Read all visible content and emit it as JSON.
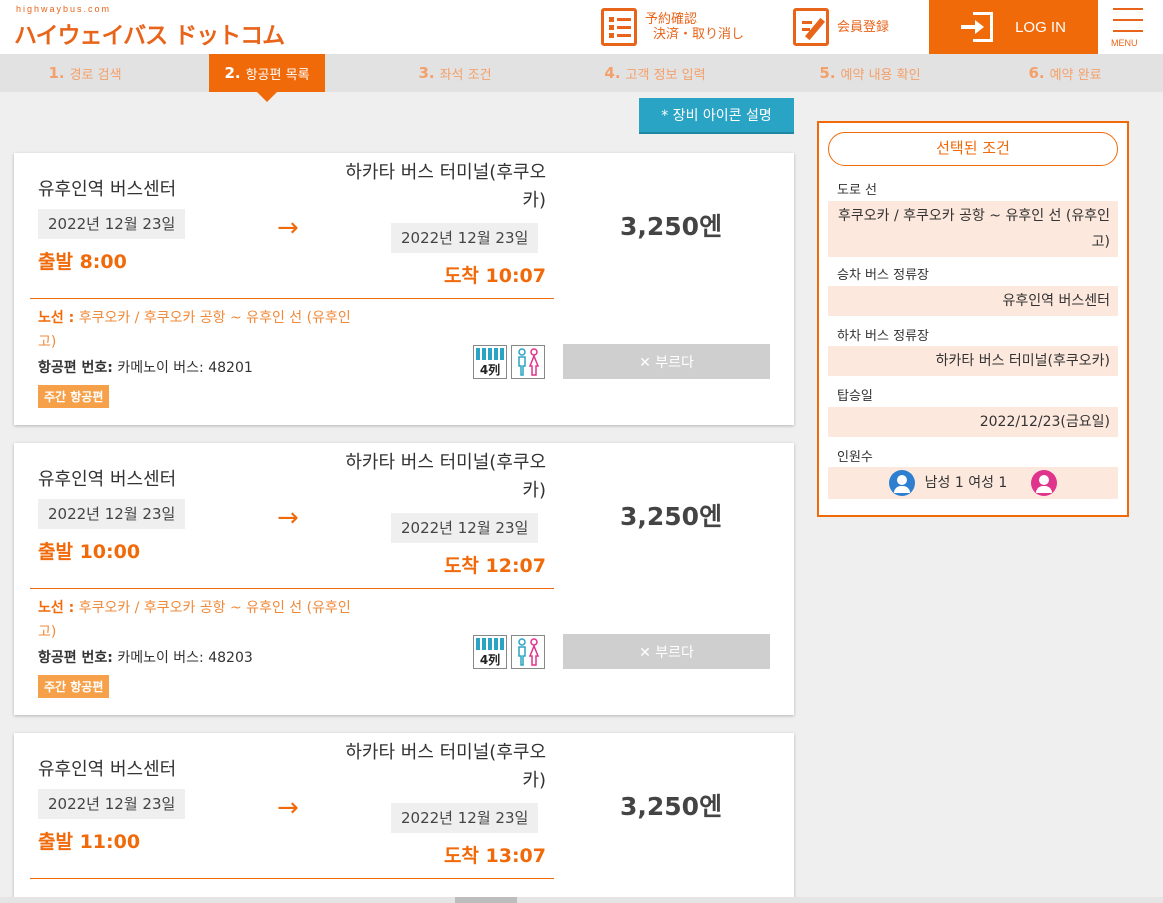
{
  "header": {
    "logo_small": "highwaybus.com",
    "logo_main": "ハイウェイバス ドットコム",
    "reserve_line1": "予約確認",
    "reserve_line2": "決済・取り消し",
    "member": "会員登録",
    "login": "LOG IN",
    "menu": "MENU"
  },
  "steps": [
    {
      "num": "1.",
      "label": "경로 검색"
    },
    {
      "num": "2.",
      "label": "항공편 목록"
    },
    {
      "num": "3.",
      "label": "좌석 조건"
    },
    {
      "num": "4.",
      "label": "고객 정보 입력"
    },
    {
      "num": "5.",
      "label": "예약 내용 확인"
    },
    {
      "num": "6.",
      "label": "예약 완료"
    }
  ],
  "equip_button": "* 장비 아이콘 설명",
  "results": [
    {
      "dep_name": "유후인역 버스센터",
      "dep_date": "2022년 12월 23일",
      "dep_time": "출발 8:00",
      "arrow": "→",
      "arr_name": "하카타 버스 터미널(후쿠오카)",
      "arr_date": "2022년 12월 23일",
      "arr_time": "도착 10:07",
      "price": "3,250엔",
      "route_label": "노선 :",
      "route": "후쿠오카 / 후쿠오카 공항 ~ 유후인 선 (유후인 고)",
      "flight_label": "항공편 번호:",
      "flight": "카메노이 버스: 48201",
      "badge": "주간 항공편",
      "seat": "4列",
      "call": "✕ 부르다"
    },
    {
      "dep_name": "유후인역 버스센터",
      "dep_date": "2022년 12월 23일",
      "dep_time": "출발 10:00",
      "arrow": "→",
      "arr_name": "하카타 버스 터미널(후쿠오카)",
      "arr_date": "2022년 12월 23일",
      "arr_time": "도착 12:07",
      "price": "3,250엔",
      "route_label": "노선 :",
      "route": "후쿠오카 / 후쿠오카 공항 ~ 유후인 선 (유후인 고)",
      "flight_label": "항공편 번호:",
      "flight": "카메노이 버스: 48203",
      "badge": "주간 항공편",
      "seat": "4列",
      "call": "✕ 부르다"
    },
    {
      "dep_name": "유후인역 버스센터",
      "dep_date": "2022년 12월 23일",
      "dep_time": "출발 11:00",
      "arrow": "→",
      "arr_name": "하카타 버스 터미널(후쿠오카)",
      "arr_date": "2022년 12월 23일",
      "arr_time": "도착 13:07",
      "price": "3,250엔"
    }
  ],
  "side": {
    "title": "선택된 조건",
    "route_label": "도로 선",
    "route_value": "후쿠오카 / 후쿠오카 공항 ~ 유후인 선 (유후인 고)",
    "board_label": "승차 버스 정류장",
    "board_value": "유후인역 버스센터",
    "alight_label": "하차 버스 정류장",
    "alight_value": "하카타 버스 터미널(후쿠오카)",
    "date_label": "탑승일",
    "date_value": "2022/12/23(금요일)",
    "pax_label": "인원수",
    "pax_value": "남성 1 여성 1"
  },
  "colors": {
    "accent": "#f06a0a",
    "info_button": "#2aa4c4",
    "male_icon": "#2e7fd0",
    "female_icon": "#e0338c"
  }
}
